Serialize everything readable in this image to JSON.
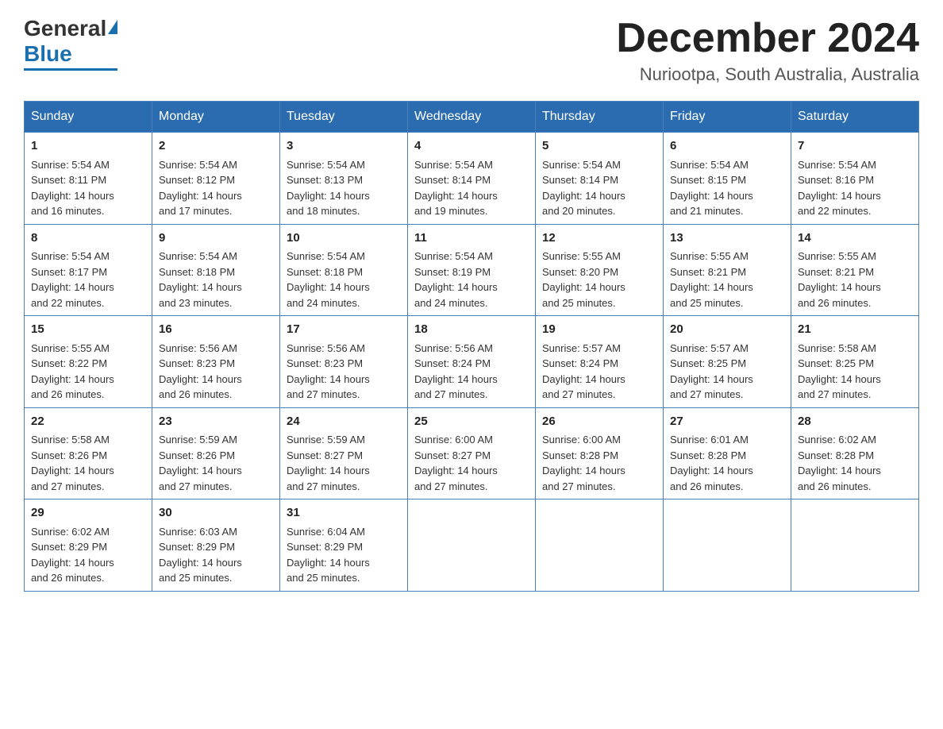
{
  "header": {
    "logo_general": "General",
    "logo_blue": "Blue",
    "month_title": "December 2024",
    "location": "Nuriootpa, South Australia, Australia"
  },
  "days_of_week": [
    "Sunday",
    "Monday",
    "Tuesday",
    "Wednesday",
    "Thursday",
    "Friday",
    "Saturday"
  ],
  "weeks": [
    [
      {
        "day": "1",
        "sunrise": "5:54 AM",
        "sunset": "8:11 PM",
        "daylight": "14 hours and 16 minutes."
      },
      {
        "day": "2",
        "sunrise": "5:54 AM",
        "sunset": "8:12 PM",
        "daylight": "14 hours and 17 minutes."
      },
      {
        "day": "3",
        "sunrise": "5:54 AM",
        "sunset": "8:13 PM",
        "daylight": "14 hours and 18 minutes."
      },
      {
        "day": "4",
        "sunrise": "5:54 AM",
        "sunset": "8:14 PM",
        "daylight": "14 hours and 19 minutes."
      },
      {
        "day": "5",
        "sunrise": "5:54 AM",
        "sunset": "8:14 PM",
        "daylight": "14 hours and 20 minutes."
      },
      {
        "day": "6",
        "sunrise": "5:54 AM",
        "sunset": "8:15 PM",
        "daylight": "14 hours and 21 minutes."
      },
      {
        "day": "7",
        "sunrise": "5:54 AM",
        "sunset": "8:16 PM",
        "daylight": "14 hours and 22 minutes."
      }
    ],
    [
      {
        "day": "8",
        "sunrise": "5:54 AM",
        "sunset": "8:17 PM",
        "daylight": "14 hours and 22 minutes."
      },
      {
        "day": "9",
        "sunrise": "5:54 AM",
        "sunset": "8:18 PM",
        "daylight": "14 hours and 23 minutes."
      },
      {
        "day": "10",
        "sunrise": "5:54 AM",
        "sunset": "8:18 PM",
        "daylight": "14 hours and 24 minutes."
      },
      {
        "day": "11",
        "sunrise": "5:54 AM",
        "sunset": "8:19 PM",
        "daylight": "14 hours and 24 minutes."
      },
      {
        "day": "12",
        "sunrise": "5:55 AM",
        "sunset": "8:20 PM",
        "daylight": "14 hours and 25 minutes."
      },
      {
        "day": "13",
        "sunrise": "5:55 AM",
        "sunset": "8:21 PM",
        "daylight": "14 hours and 25 minutes."
      },
      {
        "day": "14",
        "sunrise": "5:55 AM",
        "sunset": "8:21 PM",
        "daylight": "14 hours and 26 minutes."
      }
    ],
    [
      {
        "day": "15",
        "sunrise": "5:55 AM",
        "sunset": "8:22 PM",
        "daylight": "14 hours and 26 minutes."
      },
      {
        "day": "16",
        "sunrise": "5:56 AM",
        "sunset": "8:23 PM",
        "daylight": "14 hours and 26 minutes."
      },
      {
        "day": "17",
        "sunrise": "5:56 AM",
        "sunset": "8:23 PM",
        "daylight": "14 hours and 27 minutes."
      },
      {
        "day": "18",
        "sunrise": "5:56 AM",
        "sunset": "8:24 PM",
        "daylight": "14 hours and 27 minutes."
      },
      {
        "day": "19",
        "sunrise": "5:57 AM",
        "sunset": "8:24 PM",
        "daylight": "14 hours and 27 minutes."
      },
      {
        "day": "20",
        "sunrise": "5:57 AM",
        "sunset": "8:25 PM",
        "daylight": "14 hours and 27 minutes."
      },
      {
        "day": "21",
        "sunrise": "5:58 AM",
        "sunset": "8:25 PM",
        "daylight": "14 hours and 27 minutes."
      }
    ],
    [
      {
        "day": "22",
        "sunrise": "5:58 AM",
        "sunset": "8:26 PM",
        "daylight": "14 hours and 27 minutes."
      },
      {
        "day": "23",
        "sunrise": "5:59 AM",
        "sunset": "8:26 PM",
        "daylight": "14 hours and 27 minutes."
      },
      {
        "day": "24",
        "sunrise": "5:59 AM",
        "sunset": "8:27 PM",
        "daylight": "14 hours and 27 minutes."
      },
      {
        "day": "25",
        "sunrise": "6:00 AM",
        "sunset": "8:27 PM",
        "daylight": "14 hours and 27 minutes."
      },
      {
        "day": "26",
        "sunrise": "6:00 AM",
        "sunset": "8:28 PM",
        "daylight": "14 hours and 27 minutes."
      },
      {
        "day": "27",
        "sunrise": "6:01 AM",
        "sunset": "8:28 PM",
        "daylight": "14 hours and 26 minutes."
      },
      {
        "day": "28",
        "sunrise": "6:02 AM",
        "sunset": "8:28 PM",
        "daylight": "14 hours and 26 minutes."
      }
    ],
    [
      {
        "day": "29",
        "sunrise": "6:02 AM",
        "sunset": "8:29 PM",
        "daylight": "14 hours and 26 minutes."
      },
      {
        "day": "30",
        "sunrise": "6:03 AM",
        "sunset": "8:29 PM",
        "daylight": "14 hours and 25 minutes."
      },
      {
        "day": "31",
        "sunrise": "6:04 AM",
        "sunset": "8:29 PM",
        "daylight": "14 hours and 25 minutes."
      },
      null,
      null,
      null,
      null
    ]
  ],
  "labels": {
    "sunrise": "Sunrise:",
    "sunset": "Sunset:",
    "daylight": "Daylight:"
  }
}
